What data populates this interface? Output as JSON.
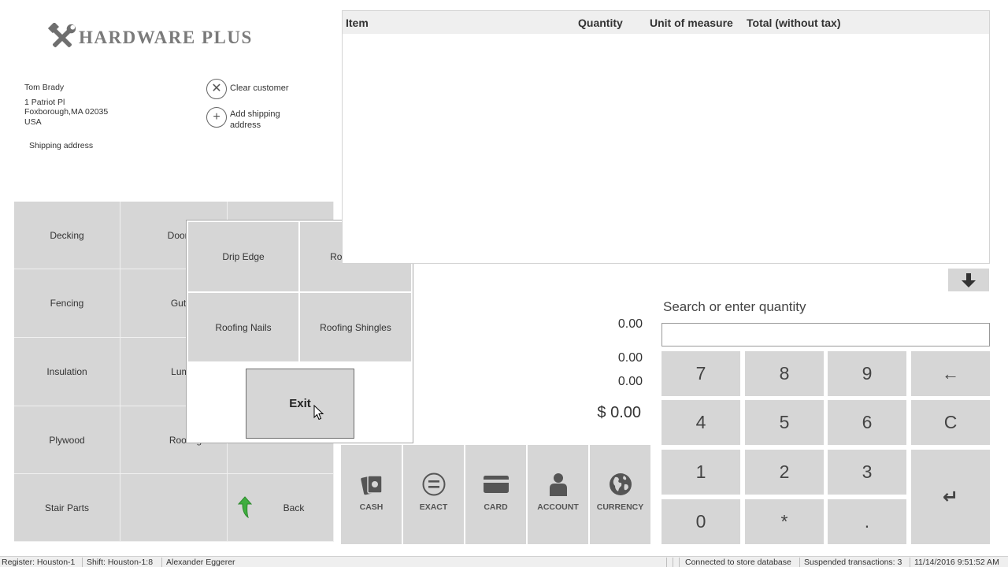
{
  "logo": {
    "text": "HARDWARE PLUS",
    "icon": "tools-icon"
  },
  "customer": {
    "name": "Tom Brady",
    "address_line1": "1 Patriot Pl",
    "address_line2": "Foxborough,MA 02035",
    "address_line3": "USA",
    "shipping_label": "Shipping address",
    "clear_label": "Clear customer",
    "add_shipping_label": "Add shipping address"
  },
  "categories": {
    "col1": [
      "Decking",
      "Fencing",
      "Insulation",
      "Plywood",
      "Stair Parts"
    ],
    "col2": [
      "Doors / Win",
      "Gutters",
      "Lumbe",
      "Roofing"
    ],
    "back_label": "Back"
  },
  "popup": {
    "items": [
      "Drip Edge",
      "Roofing Felt",
      "Roofing Nails",
      "Roofing Shingles"
    ],
    "exit_label": "Exit"
  },
  "table": {
    "headers": [
      "Item",
      "Quantity",
      "Unit of measure",
      "Total (without tax)"
    ]
  },
  "totals": {
    "line1": "0.00",
    "line2": "0.00",
    "line3": "0.00",
    "total": "$ 0.00"
  },
  "payment": {
    "buttons": [
      {
        "label": "CASH",
        "icon": "cash-icon"
      },
      {
        "label": "EXACT",
        "icon": "equals-icon"
      },
      {
        "label": "CARD",
        "icon": "card-icon"
      },
      {
        "label": "ACCOUNT",
        "icon": "person-icon"
      },
      {
        "label": "CURRENCY",
        "icon": "globe-icon"
      }
    ]
  },
  "search": {
    "label": "Search or enter quantity",
    "value": ""
  },
  "numpad": {
    "keys": [
      "7",
      "8",
      "9",
      "←",
      "4",
      "5",
      "6",
      "C",
      "1",
      "2",
      "3",
      "0",
      "*",
      "."
    ],
    "enter": "↵"
  },
  "status": {
    "register": "Register: Houston-1",
    "shift": "Shift: Houston-1:8",
    "user": "Alexander Eggerer",
    "connection": "Connected to store database",
    "suspended": "Suspended transactions: 3",
    "datetime": "11/14/2016 9:51:52 AM"
  }
}
